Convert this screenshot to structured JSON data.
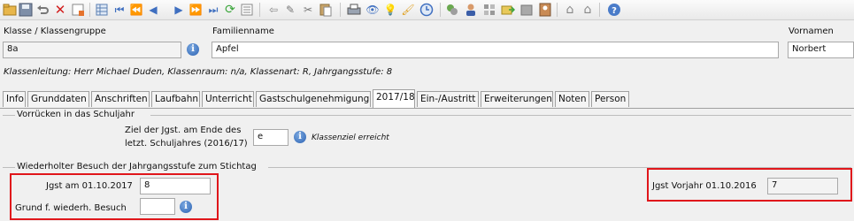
{
  "toolbar": {
    "icons": [
      "open-folder-icon",
      "save-icon",
      "undo-icon",
      "delete-icon",
      "record-icon",
      "grid-icon",
      "first-record-icon",
      "previous-page-icon",
      "previous-record-icon",
      "next-record-icon",
      "next-page-icon",
      "last-record-icon",
      "refresh-icon",
      "list-icon",
      "back-arrow-icon",
      "edit-icon",
      "cut-icon",
      "paste-icon",
      "print-icon",
      "preview-icon",
      "idea-icon",
      "brush-icon",
      "clock-icon",
      "modules-icon",
      "user-icon",
      "grid2-icon",
      "export-icon",
      "archive-icon",
      "person-card-icon",
      "home-icon",
      "home2-icon",
      "help-icon"
    ]
  },
  "header": {
    "klasse_label": "Klasse / Klassengruppe",
    "klasse_value": "8a",
    "familienname_label": "Familienname",
    "familienname_value": "Apfel",
    "vornamen_label": "Vornamen",
    "vornamen_value": "Norbert",
    "class_info": "Klassenleitung: Herr Michael Duden, Klassenraum: n/a, Klassenart: R, Jahrgangsstufe: 8"
  },
  "tabs": [
    {
      "label": "Info"
    },
    {
      "label": "Grunddaten"
    },
    {
      "label": "Anschriften"
    },
    {
      "label": "Laufbahn"
    },
    {
      "label": "Unterricht"
    },
    {
      "label": "Gastschulgenehmigung"
    },
    {
      "label": "2017/18"
    },
    {
      "label": "Ein-/Austritt"
    },
    {
      "label": "Erweiterungen"
    },
    {
      "label": "Noten"
    },
    {
      "label": "Person"
    }
  ],
  "vorruecken": {
    "group_label": "Vorrücken in das Schuljahr",
    "ziel_label_line1": "Ziel der Jgst. am Ende des",
    "ziel_label_line2": "letzt. Schuljahres (2016/17)",
    "ziel_value": "e",
    "ziel_hint": "Klassenziel erreicht"
  },
  "wiederholter": {
    "group_label": "Wiederholter Besuch der Jahrgangsstufe zum Stichtag",
    "jgst_label": "Jgst am 01.10.2017",
    "jgst_value": "8",
    "grund_label": "Grund f. wiederh. Besuch",
    "grund_value": "",
    "vorjahr_label": "Jgst Vorjahr 01.10.2016",
    "vorjahr_value": "7"
  },
  "colors": {
    "highlight": "#e0161b",
    "accent": "#2d63b3"
  }
}
